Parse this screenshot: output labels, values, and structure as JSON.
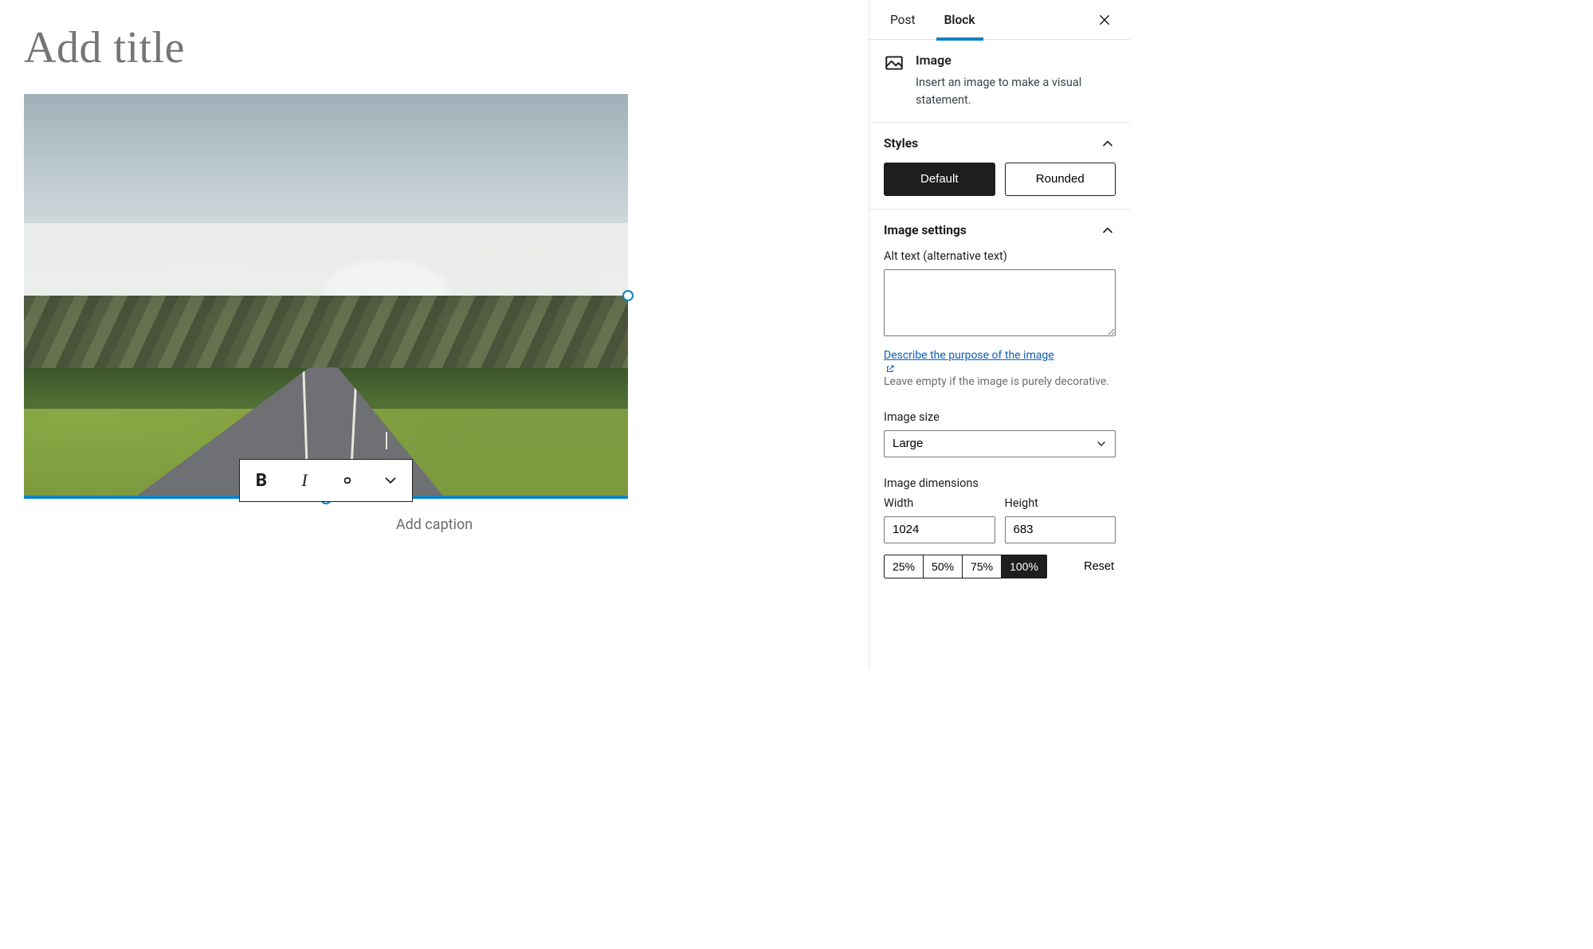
{
  "editor": {
    "title_placeholder": "Add title",
    "caption_placeholder": "Add caption"
  },
  "caption_toolbar": {
    "bold": "B",
    "italic": "I"
  },
  "sidebar": {
    "tabs": {
      "post": "Post",
      "block": "Block"
    },
    "block": {
      "name": "Image",
      "description": "Insert an image to make a visual statement."
    },
    "styles": {
      "heading": "Styles",
      "default": "Default",
      "rounded": "Rounded",
      "active": "default"
    },
    "image_settings": {
      "heading": "Image settings",
      "alt_label": "Alt text (alternative text)",
      "alt_value": "",
      "help_link": "Describe the purpose of the image",
      "help_rest": "Leave empty if the image is purely decorative.",
      "size_label": "Image size",
      "size_value": "Large",
      "dimensions_label": "Image dimensions",
      "width_label": "Width",
      "width_value": "1024",
      "height_label": "Height",
      "height_value": "683",
      "pct": [
        "25%",
        "50%",
        "75%",
        "100%"
      ],
      "pct_active": "100%",
      "reset": "Reset"
    }
  }
}
